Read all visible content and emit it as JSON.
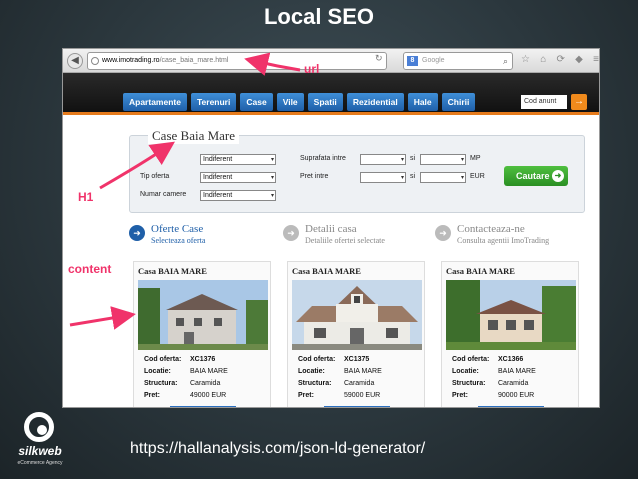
{
  "slide": {
    "title": "Local SEO",
    "footer_url": "https://hallanalysis.com/json-ld-generator/",
    "logo_name": "silkweb",
    "logo_tagline": "eCommerce Agency"
  },
  "annotations": {
    "url": "url",
    "h1": "H1",
    "content": "content",
    "color": "#f0336a"
  },
  "browser": {
    "url_domain": "www.imotrading.ro",
    "url_path": "/case_baia_mare.html",
    "search_placeholder": "Google"
  },
  "site": {
    "nav": [
      "Apartamente",
      "Terenuri",
      "Case",
      "Vile",
      "Spatii",
      "Rezidential",
      "Hale",
      "Chirii"
    ],
    "cod_placeholder": "Cod anunt",
    "cod_go": "→"
  },
  "search": {
    "title": "Case Baia Mare",
    "tip_oferta_label": "Tip oferta",
    "numar_camere_label": "Numar camere",
    "suprafata_label": "Suprafata intre",
    "pret_label": "Pret intre",
    "select_value": "Indiferent",
    "si": "si",
    "mp": "MP",
    "eur": "EUR",
    "button": "Cautare"
  },
  "steps": [
    {
      "title": "Oferte Case",
      "sub": "Selecteaza oferta",
      "color": "#1f5fa8",
      "icon": "1"
    },
    {
      "title": "Detalii casa",
      "sub": "Detaliile ofertei selectate",
      "color": "#888888",
      "icon": "→"
    },
    {
      "title": "Contacteaza-ne",
      "sub": "Consulta agentii ImoTrading",
      "color": "#888888",
      "icon": "→"
    }
  ],
  "cards": [
    {
      "title": "Casa BAIA MARE",
      "cod": "XC1376",
      "locatie": "BAIA MARE",
      "structura": "Caramida",
      "pret": "49000 EUR"
    },
    {
      "title": "Casa BAIA MARE",
      "cod": "XC1375",
      "locatie": "BAIA MARE",
      "structura": "Caramida",
      "pret": "59000 EUR"
    },
    {
      "title": "Casa BAIA MARE",
      "cod": "XC1366",
      "locatie": "BAIA MARE",
      "structura": "Caramida",
      "pret": "90000 EUR"
    }
  ],
  "card_labels": {
    "cod": "Cod oferta:",
    "locatie": "Locatie:",
    "structura": "Structura:",
    "pret": "Pret:"
  }
}
